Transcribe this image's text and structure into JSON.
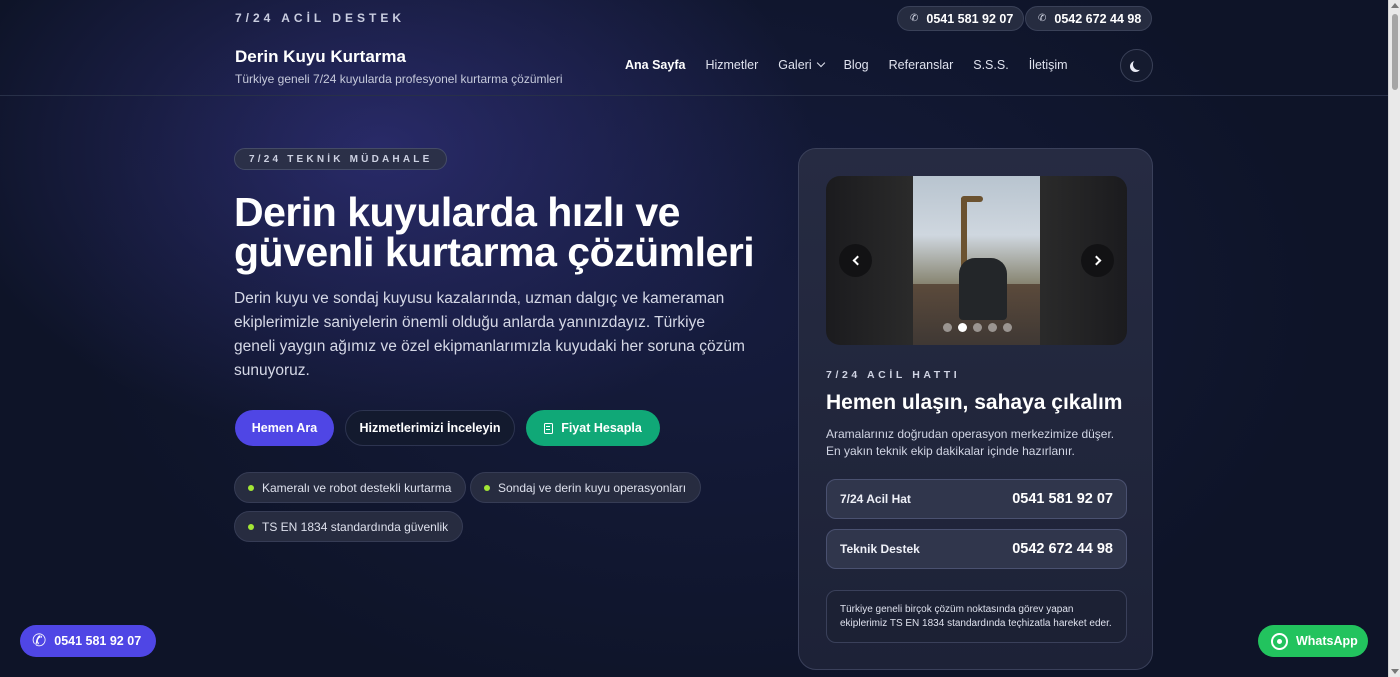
{
  "topbar": {
    "tag": "7/24 ACİL DESTEK",
    "phone1": "0541 581 92 07",
    "phone2": "0542 672 44 98"
  },
  "brand": {
    "name": "Derin Kuyu Kurtarma",
    "tagline": "Türkiye geneli 7/24 kuyularda profesyonel kurtarma çözümleri"
  },
  "nav": {
    "items": [
      "Ana Sayfa",
      "Hizmetler",
      "Galeri",
      "Blog",
      "Referanslar",
      "S.S.S.",
      "İletişim"
    ],
    "active": "Ana Sayfa"
  },
  "hero": {
    "eyebrow": "7/24 TEKNİK MÜDAHALE",
    "title_line1": "Derin kuyularda hızlı ve",
    "title_line2": "güvenli kurtarma çözümleri",
    "description": "Derin kuyu ve sondaj kuyusu kazalarında, uzman dalgıç ve kameraman ekiplerimizle saniyelerin önemli olduğu anlarda yanınızdayız. Türkiye geneli yaygın ağımız ve özel ekipmanlarımızla kuyudaki her soruna çözüm sunuyoruz.",
    "btn_primary": "Hemen Ara",
    "btn_secondary": "Hizmetlerimizi İnceleyin",
    "btn_green": "Fiyat Hesapla",
    "chips": [
      "Kameralı ve robot destekli kurtarma",
      "Sondaj ve derin kuyu operasyonları",
      "TS EN 1834 standardında güvenlik"
    ]
  },
  "card": {
    "slider": {
      "slide_count": 5,
      "active_slide": 2
    },
    "kicker": "7/24 ACİL HATTI",
    "title": "Hemen ulaşın, sahaya çıkalım",
    "description": "Aramalarınız doğrudan operasyon merkezimize düşer. En yakın teknik ekip dakikalar içinde hazırlanır.",
    "lines": [
      {
        "label": "7/24 Acil Hat",
        "number": "0541 581 92 07"
      },
      {
        "label": "Teknik Destek",
        "number": "0542 672 44 98"
      }
    ],
    "note": "Türkiye geneli birçok çözüm noktasında görev yapan ekiplerimiz TS EN 1834 standardında teçhizatla hareket eder."
  },
  "floating": {
    "call": "0541 581 92 07",
    "whatsapp": "WhatsApp"
  },
  "colors": {
    "accent": "#4f46e5",
    "green": "#10a877",
    "whatsapp": "#22c35e",
    "chip_dot": "#a3e635"
  }
}
